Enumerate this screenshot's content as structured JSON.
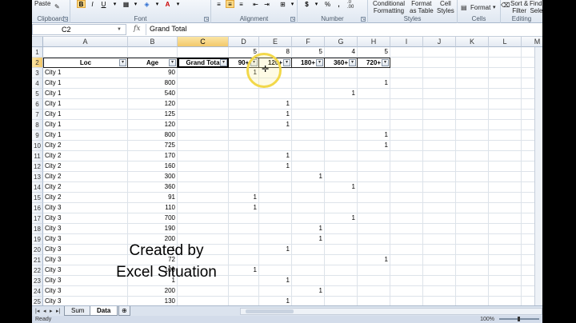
{
  "ribbon": {
    "clipboard": {
      "paste": "Paste",
      "label": "Clipboard"
    },
    "font": {
      "bold": "B",
      "italic": "I",
      "underline": "U",
      "label": "Font"
    },
    "alignment": {
      "label": "Alignment"
    },
    "number": {
      "currency": "$",
      "percent": "%",
      "comma": ",",
      "inc_dec": ".0\n.00",
      "label": "Number"
    },
    "styles": {
      "conditional": "Conditional\nFormatting",
      "format_table": "Format\nas Table",
      "cell_styles": "Cell\nStyles",
      "label": "Styles"
    },
    "cells": {
      "format": "Format",
      "label": "Cells"
    },
    "editing": {
      "sort_filter": "Sort &\nFilter",
      "find_select": "Find &\nSelect",
      "label": "Editing"
    }
  },
  "formula_bar": {
    "name_box": "C2",
    "fx": "fx",
    "value": "Grand Total"
  },
  "columns": [
    "A",
    "B",
    "C",
    "D",
    "E",
    "F",
    "G",
    "H",
    "I",
    "J",
    "K",
    "L",
    "M"
  ],
  "selected_column": "C",
  "row1": {
    "D": "5",
    "E": "8",
    "F": "5",
    "G": "4",
    "H": "5"
  },
  "header_row": {
    "A": "Loc",
    "B": "Age",
    "C": "Grand Tota",
    "D": "90+",
    "E": "120+",
    "F": "180+",
    "G": "360+",
    "H": "720+"
  },
  "data_rows": [
    {
      "n": "3",
      "loc": "City 1",
      "age": "90",
      "d": "1"
    },
    {
      "n": "4",
      "loc": "City 1",
      "age": "800",
      "h": "1"
    },
    {
      "n": "5",
      "loc": "City 1",
      "age": "540",
      "g": "1"
    },
    {
      "n": "6",
      "loc": "City 1",
      "age": "120",
      "e": "1"
    },
    {
      "n": "7",
      "loc": "City 1",
      "age": "125",
      "e": "1"
    },
    {
      "n": "8",
      "loc": "City 1",
      "age": "120",
      "e": "1"
    },
    {
      "n": "9",
      "loc": "City 1",
      "age": "800",
      "h": "1"
    },
    {
      "n": "10",
      "loc": "City 2",
      "age": "725",
      "h": "1"
    },
    {
      "n": "11",
      "loc": "City 2",
      "age": "170",
      "e": "1"
    },
    {
      "n": "12",
      "loc": "City 2",
      "age": "160",
      "e": "1"
    },
    {
      "n": "13",
      "loc": "City 2",
      "age": "300",
      "f": "1"
    },
    {
      "n": "14",
      "loc": "City 2",
      "age": "360",
      "g": "1"
    },
    {
      "n": "15",
      "loc": "City 2",
      "age": "91",
      "d": "1"
    },
    {
      "n": "16",
      "loc": "City 3",
      "age": "110",
      "d": "1"
    },
    {
      "n": "17",
      "loc": "City 3",
      "age": "700",
      "g": "1"
    },
    {
      "n": "18",
      "loc": "City 3",
      "age": "190",
      "f": "1"
    },
    {
      "n": "19",
      "loc": "City 3",
      "age": "200",
      "f": "1"
    },
    {
      "n": "20",
      "loc": "City 3",
      "age": "1",
      "e": "1"
    },
    {
      "n": "21",
      "loc": "City 3",
      "age": "72",
      "h": "1"
    },
    {
      "n": "22",
      "loc": "City 3",
      "age": "100",
      "d": "1"
    },
    {
      "n": "23",
      "loc": "City 3",
      "age": "1",
      "e": "1"
    },
    {
      "n": "24",
      "loc": "City 3",
      "age": "200",
      "f": "1"
    },
    {
      "n": "25",
      "loc": "City 3",
      "age": "130",
      "e": "1"
    }
  ],
  "watermark": {
    "line1": "Created by",
    "line2": "Excel Situation"
  },
  "tabs": [
    {
      "label": "Sum",
      "active": false
    },
    {
      "label": "Data",
      "active": true
    }
  ],
  "status": {
    "ready": "Ready",
    "zoom": "100%"
  }
}
